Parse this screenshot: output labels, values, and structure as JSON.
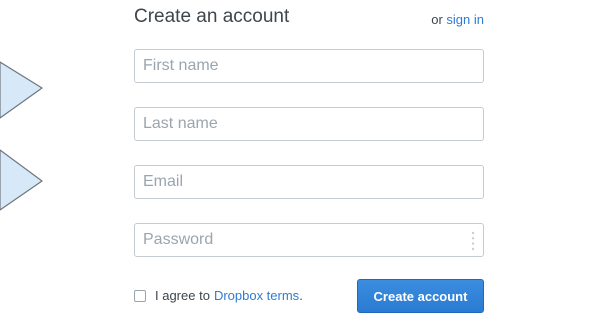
{
  "form": {
    "title": "Create an account",
    "or_label": "or",
    "signin_label": "sign in",
    "first_name_placeholder": "First name",
    "last_name_placeholder": "Last name",
    "email_placeholder": "Email",
    "password_placeholder": "Password",
    "agree_label": "I agree to",
    "terms_link": "Dropbox terms",
    "terms_period": ".",
    "submit_label": "Create account"
  },
  "icons": {
    "illustration": "dropbox-logo-partial-icon",
    "password_manager": "password-dots-icon"
  },
  "colors": {
    "link": "#2e7cd6",
    "button": "#2a7bd2",
    "text": "#3d464d",
    "placeholder": "#9aa5ae",
    "logo_fill": "#d7e9f8"
  }
}
